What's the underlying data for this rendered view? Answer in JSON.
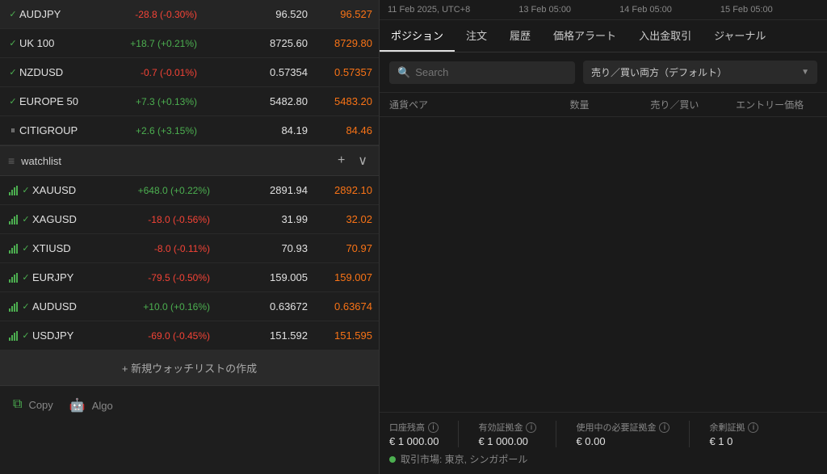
{
  "left": {
    "top_rows": [
      {
        "symbol": "AUDJPY",
        "change": "-28.8 (-0.30%)",
        "change_type": "negative",
        "indicator": "check",
        "bid": "96.520",
        "ask": "96.527"
      },
      {
        "symbol": "UK 100",
        "change": "+18.7 (+0.21%)",
        "change_type": "positive",
        "indicator": "check",
        "bid": "8725.60",
        "ask": "8729.80"
      },
      {
        "symbol": "NZDUSD",
        "change": "-0.7 (-0.01%)",
        "change_type": "negative",
        "indicator": "check",
        "bid": "0.57354",
        "ask": "0.57357"
      },
      {
        "symbol": "EUROPE 50",
        "change": "+7.3 (+0.13%)",
        "change_type": "positive",
        "indicator": "check",
        "bid": "5482.80",
        "ask": "5483.20"
      },
      {
        "symbol": "CITIGROUP",
        "change": "+2.6 (+3.15%)",
        "change_type": "positive",
        "indicator": "bars",
        "bid": "84.19",
        "ask": "84.46"
      }
    ],
    "watchlist": {
      "label": "watchlist",
      "items": [
        {
          "symbol": "XAUUSD",
          "change": "+648.0 (+0.22%)",
          "change_type": "positive",
          "indicator": "check",
          "bid": "2891.94",
          "ask": "2892.10"
        },
        {
          "symbol": "XAGUSD",
          "change": "-18.0 (-0.56%)",
          "change_type": "negative",
          "indicator": "check",
          "bid": "31.99",
          "ask": "32.02"
        },
        {
          "symbol": "XTIUSD",
          "change": "-8.0 (-0.11%)",
          "change_type": "negative",
          "indicator": "check",
          "bid": "70.93",
          "ask": "70.97"
        },
        {
          "symbol": "EURJPY",
          "change": "-79.5 (-0.50%)",
          "change_type": "negative",
          "indicator": "check",
          "bid": "159.005",
          "ask": "159.007"
        },
        {
          "symbol": "AUDUSD",
          "change": "+10.0 (+0.16%)",
          "change_type": "positive",
          "indicator": "check",
          "bid": "0.63672",
          "ask": "0.63674"
        },
        {
          "symbol": "USDJPY",
          "change": "-69.0 (-0.45%)",
          "change_type": "negative",
          "indicator": "check",
          "bid": "151.592",
          "ask": "151.595"
        }
      ],
      "create_button": "+ 新規ウォッチリストの作成"
    },
    "toolbar": {
      "copy_label": "Copy",
      "algo_label": "Algo"
    }
  },
  "right": {
    "chart_dates": [
      "11 Feb 2025, UTC+8",
      "13 Feb 05:00",
      "14 Feb 05:00",
      "15 Feb 05:00"
    ],
    "tabs": [
      {
        "label": "ポジション",
        "active": true
      },
      {
        "label": "注文",
        "active": false
      },
      {
        "label": "履歴",
        "active": false
      },
      {
        "label": "価格アラート",
        "active": false
      },
      {
        "label": "入出金取引",
        "active": false
      },
      {
        "label": "ジャーナル",
        "active": false
      }
    ],
    "search": {
      "placeholder": "Search",
      "filter_label": "売り／買い両方（デフォルト）"
    },
    "table_headers": [
      "通貨ペア",
      "数量",
      "売り／買い",
      "エントリー価格"
    ],
    "account": {
      "balance_label": "口座残高",
      "balance_value": "€ 1 000.00",
      "equity_label": "有効証拠金",
      "equity_value": "€ 1 000.00",
      "margin_used_label": "使用中の必要証拠金",
      "margin_used_value": "€ 0.00",
      "margin_free_label": "余剰証拠",
      "margin_free_value": "€ 1 0"
    },
    "market_status": "取引市場: 東京, シンガポール"
  }
}
